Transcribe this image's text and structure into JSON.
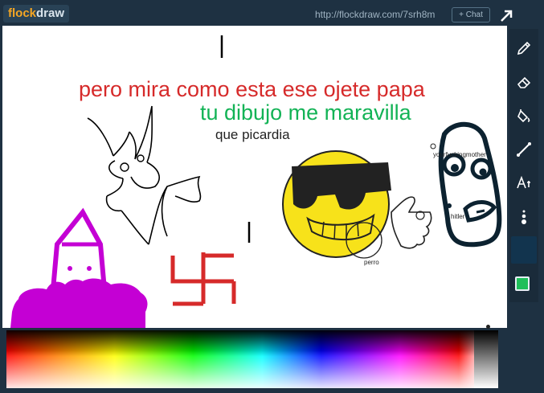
{
  "app": {
    "logo_part1": "flock",
    "logo_part2": "draw",
    "url": "http://flockdraw.com/7srh8m",
    "chat_label": "+ Chat"
  },
  "canvas": {
    "text_red": "pero mira como esta ese ojete papa",
    "text_green": "tu dibujo me maravilla",
    "text_black": "que picardia",
    "label_perro": "perro",
    "label_hitler": "hitler",
    "label_mother": "yourfuckingmother"
  },
  "colors": {
    "red": "#d62a2a",
    "green": "#13b356",
    "magenta": "#c400d4",
    "yellow": "#f7e21a",
    "current_color": "#1fbf5a"
  },
  "tools": [
    {
      "name": "pencil-icon"
    },
    {
      "name": "eraser-icon"
    },
    {
      "name": "fill-icon"
    },
    {
      "name": "line-icon"
    },
    {
      "name": "text-icon"
    },
    {
      "name": "brush-size-icon"
    }
  ]
}
